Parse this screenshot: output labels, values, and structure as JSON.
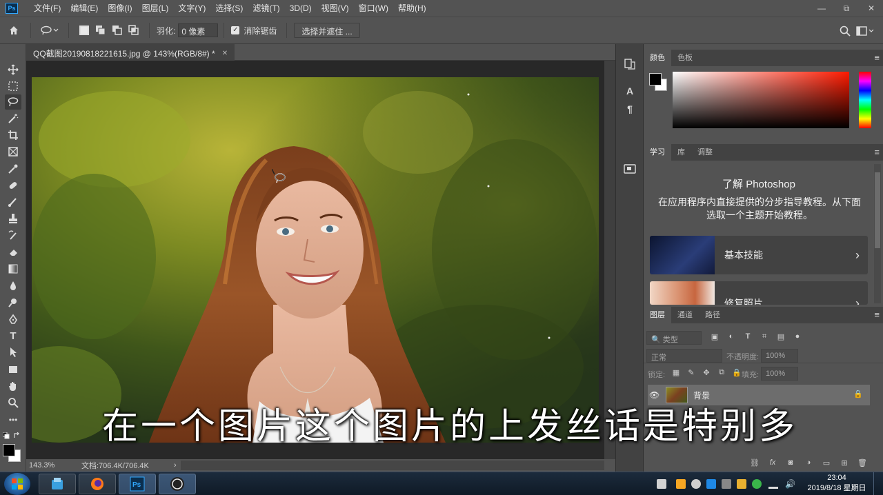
{
  "app": {
    "logo_text": "Ps"
  },
  "menubar": {
    "items": [
      "文件(F)",
      "编辑(E)",
      "图像(I)",
      "图层(L)",
      "文字(Y)",
      "选择(S)",
      "滤镜(T)",
      "3D(D)",
      "视图(V)",
      "窗口(W)",
      "帮助(H)"
    ],
    "win_controls": [
      "—",
      "⧉",
      "✕"
    ]
  },
  "options": {
    "feather_label": "羽化:",
    "feather_value": "0 像素",
    "antialias_label": "消除锯齿",
    "antialias_checked": true,
    "select_mask_button": "选择并遮住 ..."
  },
  "document": {
    "tab_title": "QQ截图20190818221615.jpg @ 143%(RGB/8#) *",
    "tab_close": "✕"
  },
  "status": {
    "zoom": "143.3%",
    "doc_info": "文档:706.4K/706.4K",
    "arrow": "›"
  },
  "panels": {
    "color": {
      "tabs": [
        "颜色",
        "色板"
      ],
      "accent": "#ff2000"
    },
    "learn": {
      "tabs": [
        "学习",
        "库",
        "调整"
      ],
      "title": "了解 Photoshop",
      "description": "在应用程序内直接提供的分步指导教程。从下面选取一个主题开始教程。",
      "cards": [
        {
          "label": "基本技能"
        },
        {
          "label": "修复照片"
        }
      ]
    },
    "layers": {
      "tabs": [
        "图层",
        "通道",
        "路径"
      ],
      "filter_placeholder": "类型",
      "blend_mode": "正常",
      "opacity_label": "不透明度:",
      "opacity_value": "100%",
      "lock_label": "锁定:",
      "fill_label": "填充:",
      "fill_value": "100%",
      "layers": [
        {
          "name": "背景",
          "visible": true,
          "locked": true
        }
      ]
    }
  },
  "subtitle": {
    "text": "在一个图片这个图片的上发丝话是特别多"
  },
  "taskbar": {
    "time": "23:04",
    "date": "2019/8/18 星期日"
  }
}
